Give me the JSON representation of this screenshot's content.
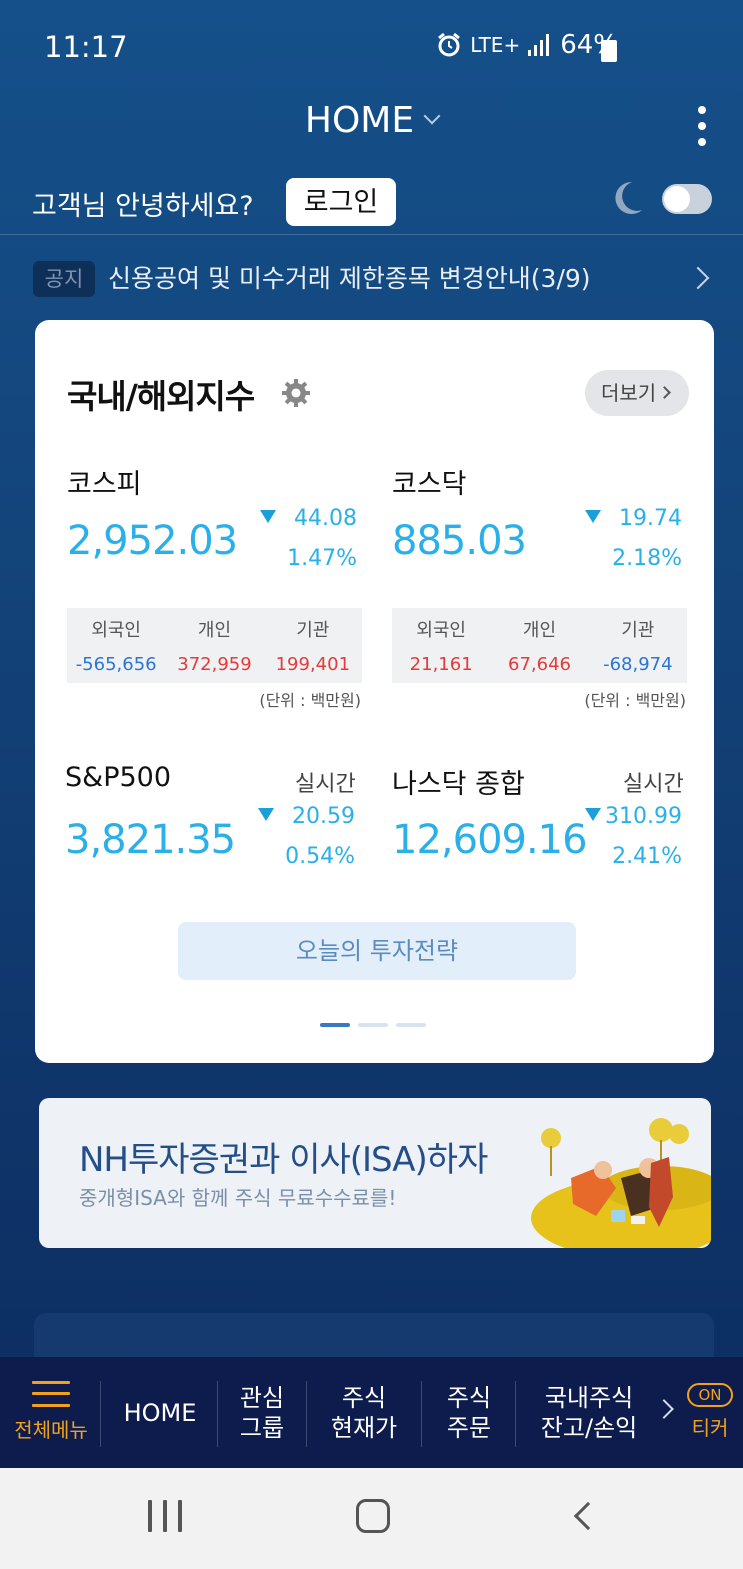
{
  "status": {
    "time": "11:17",
    "network": "LTE+",
    "battery": "64%"
  },
  "header": {
    "title": "HOME"
  },
  "user": {
    "greeting": "고객님 안녕하세요?",
    "login_label": "로그인"
  },
  "notice": {
    "badge": "공지",
    "text": "신용공여 및 미수거래 제한종목 변경안내(3/9)"
  },
  "index_card": {
    "title": "국내/해외지수",
    "more_label": "더보기",
    "kospi": {
      "name": "코스피",
      "value": "2,952.03",
      "change": "44.08",
      "rate": "1.47%",
      "flow_headers": [
        "외국인",
        "개인",
        "기관"
      ],
      "flow_values": [
        "-565,656",
        "372,959",
        "199,401"
      ],
      "unit": "(단위 : 백만원)"
    },
    "kosdaq": {
      "name": "코스닥",
      "value": "885.03",
      "change": "19.74",
      "rate": "2.18%",
      "flow_headers": [
        "외국인",
        "개인",
        "기관"
      ],
      "flow_values": [
        "21,161",
        "67,646",
        "-68,974"
      ],
      "unit": "(단위 : 백만원)"
    },
    "sp500": {
      "name": "S&P500",
      "tag": "실시간",
      "value": "3,821.35",
      "change": "20.59",
      "rate": "0.54%"
    },
    "nasdaq": {
      "name": "나스닥 종합",
      "tag": "실시간",
      "value": "12,609.16",
      "change": "310.99",
      "rate": "2.41%"
    },
    "strategy_label": "오늘의 투자전략",
    "pager": {
      "count": 3,
      "active": 1
    }
  },
  "banner": {
    "title": "NH투자증권과 이사(ISA)하자",
    "subtitle": "중개형ISA와 함께 주식 무료수수료를!"
  },
  "bottom_nav": {
    "menu": "전체메뉴",
    "home": "HOME",
    "watch_line1": "관심",
    "watch_line2": "그룹",
    "quote_line1": "주식",
    "quote_line2": "현재가",
    "order_line1": "주식",
    "order_line2": "주문",
    "balance_line1": "국내주식",
    "balance_line2": "잔고/손익",
    "ticker_badge": "ON",
    "ticker": "티커"
  },
  "colors": {
    "accent_blue": "#2ab0e8",
    "up_red": "#e53a3a",
    "down_blue": "#2b74d8",
    "nav_orange": "#f3a11b",
    "nav_bg": "#0d1c4d"
  }
}
